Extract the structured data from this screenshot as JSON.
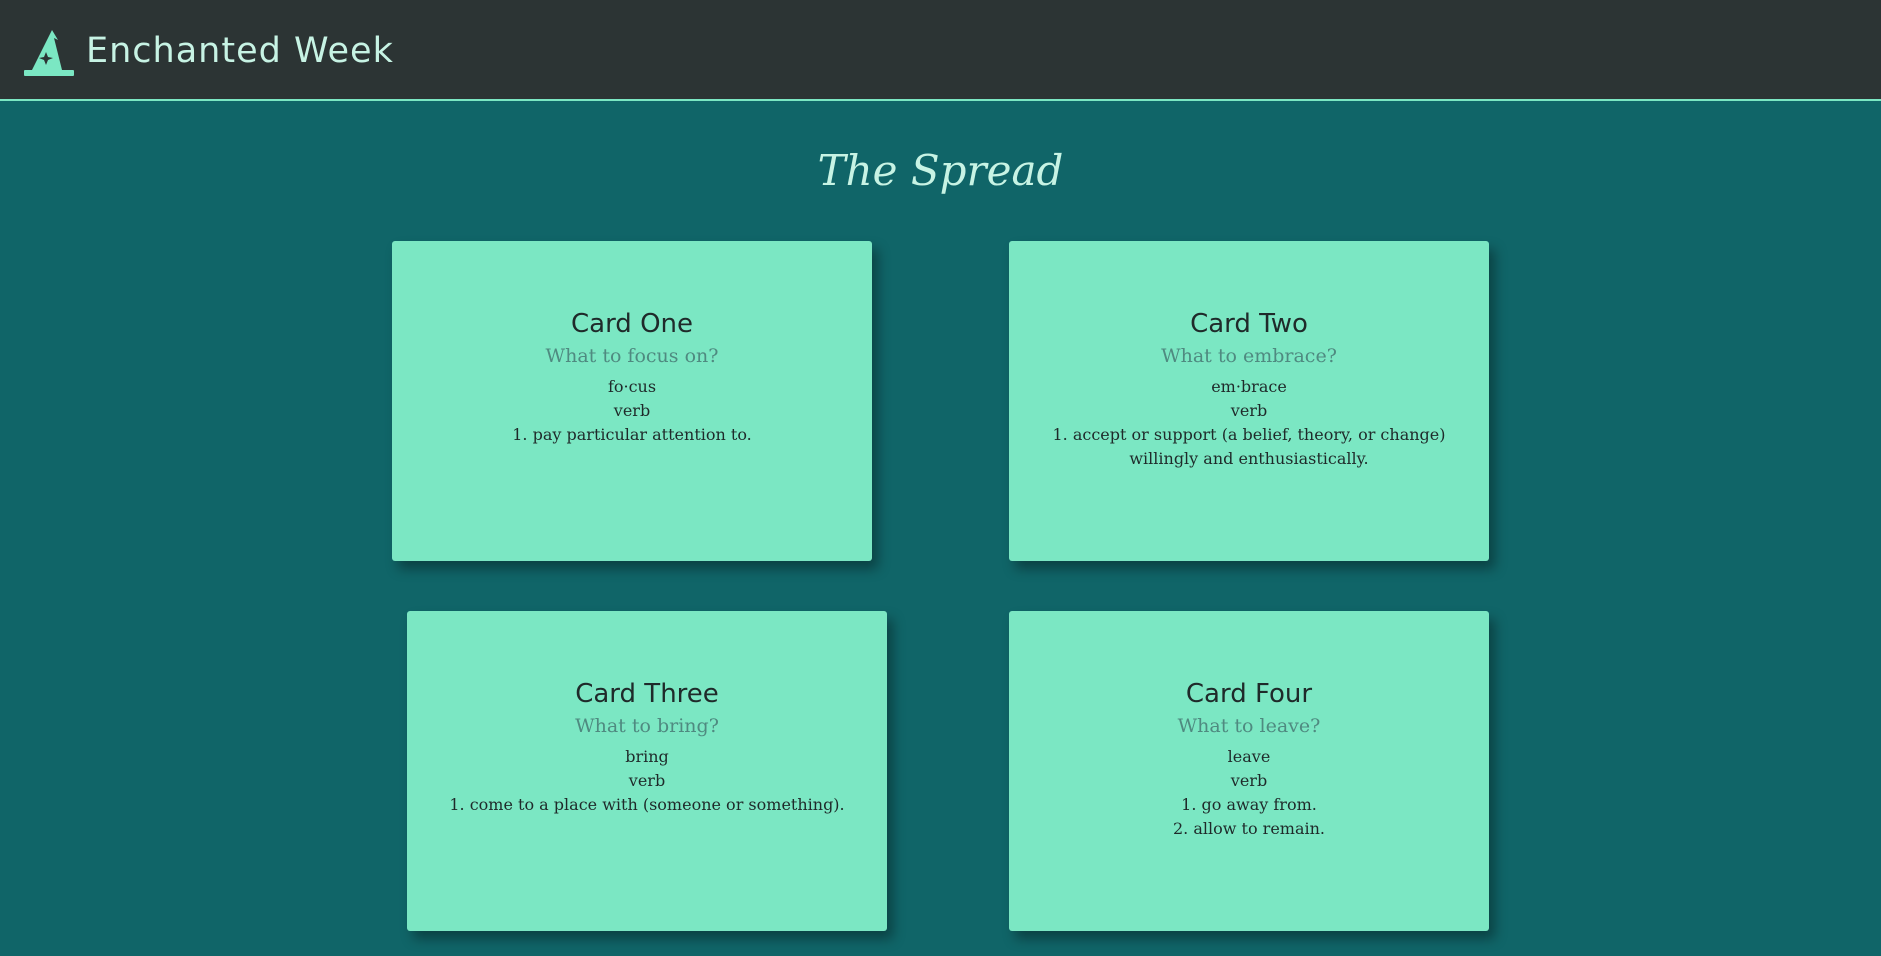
{
  "header": {
    "brand": "Enchanted Week",
    "logo_icon": "wizard-hat-icon",
    "accent_color": "#7be7c3",
    "background_color": "#2c3434"
  },
  "page": {
    "title": "The Spread",
    "background_color": "#106568"
  },
  "cards": [
    {
      "title": "Card One",
      "question": "What to focus on?",
      "word": "fo·cus",
      "part_of_speech": "verb",
      "definitions": [
        "1. pay particular attention to."
      ]
    },
    {
      "title": "Card Two",
      "question": "What to embrace?",
      "word": "em·brace",
      "part_of_speech": "verb",
      "definitions": [
        "1. accept or support (a belief, theory, or change) willingly and enthusiastically."
      ]
    },
    {
      "title": "Card Three",
      "question": "What to bring?",
      "word": "bring",
      "part_of_speech": "verb",
      "definitions": [
        "1. come to a place with (someone or something)."
      ]
    },
    {
      "title": "Card Four",
      "question": "What to leave?",
      "word": "leave",
      "part_of_speech": "verb",
      "definitions": [
        "1. go away from.",
        "2. allow to remain."
      ]
    }
  ]
}
